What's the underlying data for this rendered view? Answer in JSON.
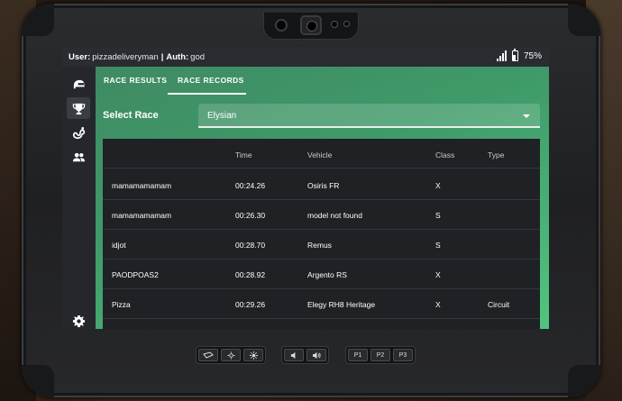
{
  "status": {
    "user_label": "User:",
    "user_value": "pizzadeliveryman",
    "separator": "|",
    "auth_label": "Auth:",
    "auth_value": "god",
    "battery": "75%"
  },
  "sidebar": {
    "items": [
      {
        "icon": "helmet-icon",
        "active": false
      },
      {
        "icon": "trophy-icon",
        "active": true
      },
      {
        "icon": "track-icon",
        "active": false
      },
      {
        "icon": "users-icon",
        "active": false
      },
      {
        "icon": "gear-icon",
        "active": false
      }
    ]
  },
  "tabs": [
    {
      "label": "RACE RESULTS",
      "active": false
    },
    {
      "label": "RACE RECORDS",
      "active": true
    }
  ],
  "select": {
    "label": "Select Race",
    "value": "Elysian"
  },
  "table": {
    "headers": [
      "",
      "Time",
      "Vehicle",
      "Class",
      "Type"
    ],
    "rows": [
      [
        "mamamamamam",
        "00:24.26",
        "Osiris FR",
        "X",
        ""
      ],
      [
        "mamamamamam",
        "00:26.30",
        "model not found",
        "S",
        ""
      ],
      [
        "idjot",
        "00:28.70",
        "Remus",
        "S",
        ""
      ],
      [
        "PAODPOAS2",
        "00:28.92",
        "Argento RS",
        "X",
        ""
      ],
      [
        "Pizza",
        "00:29.26",
        "Elegy RH8 Heritage",
        "X",
        "Circuit"
      ]
    ]
  },
  "hardware_buttons": {
    "group1": [
      "camera-icon",
      "brightness-down-icon",
      "brightness-up-icon"
    ],
    "group2": [
      "volume-down-icon",
      "volume-up-icon"
    ],
    "group3": [
      "P1",
      "P2",
      "P3"
    ]
  },
  "colors": {
    "accent_green": "#4fb878",
    "panel_dark": "#1f2125"
  }
}
